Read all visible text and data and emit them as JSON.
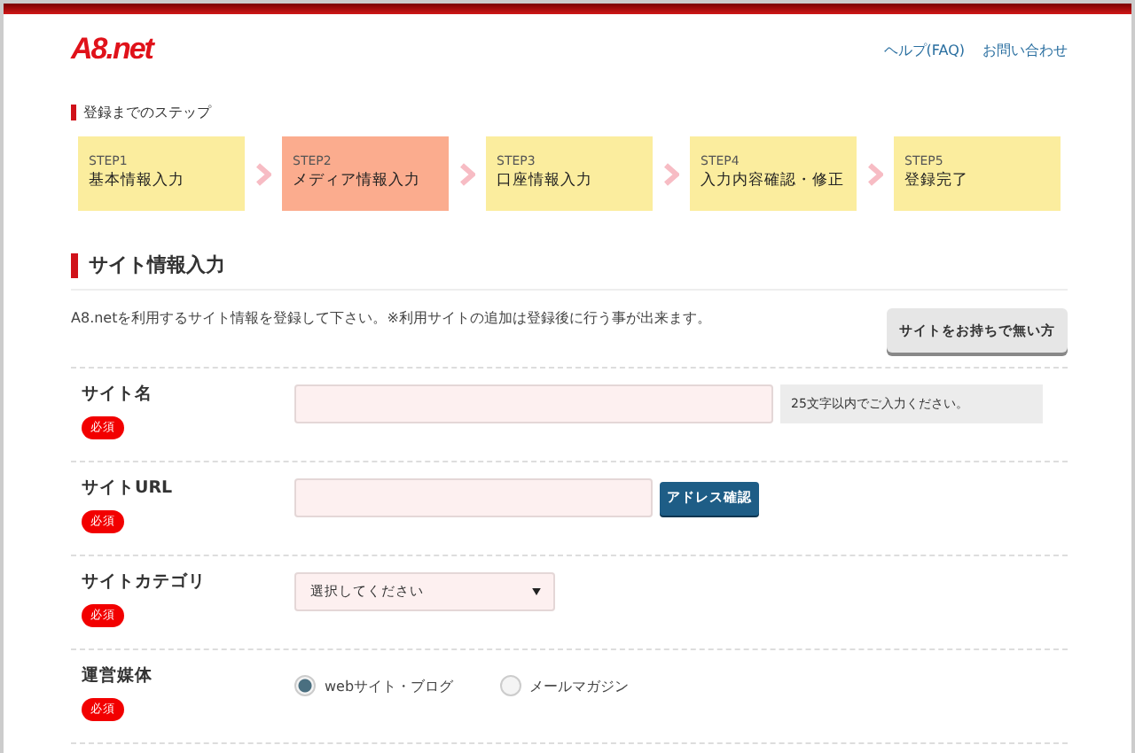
{
  "header": {
    "logo": "A8.net",
    "links": [
      "ヘルプ(FAQ)",
      "お問い合わせ"
    ]
  },
  "steps_section": {
    "title": "登録までのステップ",
    "steps": [
      {
        "label": "STEP1",
        "name": "基本情報入力",
        "selected": false
      },
      {
        "label": "STEP2",
        "name": "メディア情報入力",
        "selected": true
      },
      {
        "label": "STEP3",
        "name": "口座情報入力",
        "selected": false
      },
      {
        "label": "STEP4",
        "name": "入力内容確認・修正",
        "selected": false
      },
      {
        "label": "STEP5",
        "name": "登録完了",
        "selected": false
      }
    ]
  },
  "form": {
    "title": "サイト情報入力",
    "description": "A8.netを利用するサイト情報を登録して下さい。※利用サイトの追加は登録後に行う事が出来ます。",
    "side_button": "サイトをお持ちで無い方",
    "rows": [
      {
        "kind": "text",
        "label": "サイト名",
        "badge": "必須",
        "hint": "25文字以内でご入力ください。"
      },
      {
        "kind": "url",
        "label": "サイトURL",
        "badge": "必須",
        "button": "アドレス確認"
      },
      {
        "kind": "select",
        "label": "サイトカテゴリ",
        "badge": "必須",
        "value": "選択してください"
      },
      {
        "kind": "radio",
        "label": "運営媒体",
        "badge": "必須",
        "options": [
          {
            "label": "webサイト・ブログ",
            "selected": true
          },
          {
            "label": "メールマガジン",
            "selected": false
          }
        ]
      }
    ]
  }
}
